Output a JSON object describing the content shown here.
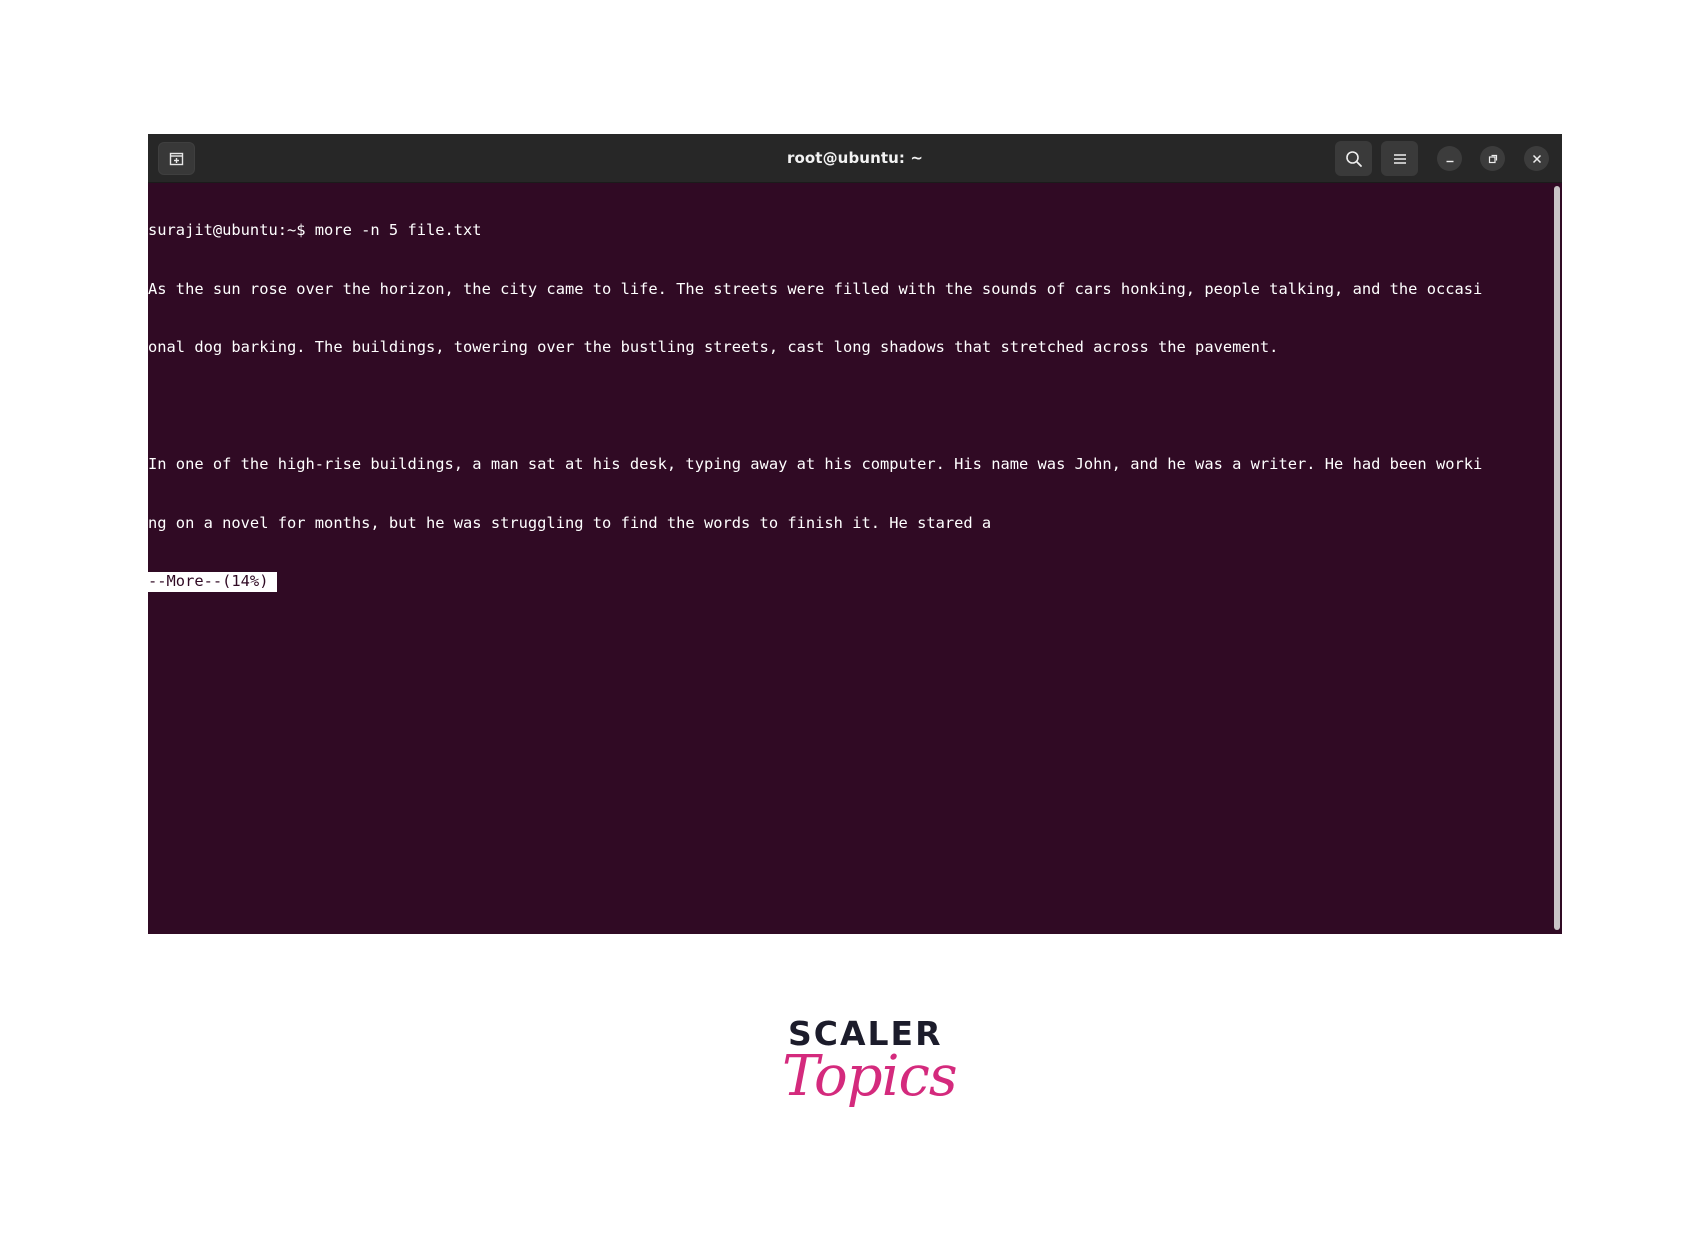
{
  "window": {
    "title": "root@ubuntu: ~"
  },
  "icons": {
    "new_tab": "new-tab-icon",
    "search": "search-icon",
    "menu": "hamburger-menu-icon",
    "minimize": "minimize-icon",
    "maximize": "maximize-icon",
    "close": "close-icon"
  },
  "terminal": {
    "lines": [
      "surajit@ubuntu:~$ more -n 5 file.txt",
      "As the sun rose over the horizon, the city came to life. The streets were filled with the sounds of cars honking, people talking, and the occasi",
      "onal dog barking. The buildings, towering over the bustling streets, cast long shadows that stretched across the pavement.",
      "",
      "In one of the high-rise buildings, a man sat at his desk, typing away at his computer. His name was John, and he was a writer. He had been worki",
      "ng on a novel for months, but he was struggling to find the words to finish it. He stared a"
    ],
    "more_prompt": "--More--(14%)",
    "more_percent": 14
  },
  "colors": {
    "terminal_bg": "#300a24",
    "titlebar_bg": "#272727",
    "text": "#ffffff",
    "logo_dark": "#1c1c2b",
    "logo_pink": "#d42a7d"
  },
  "logo": {
    "line1": "SCALER",
    "line2": "Topics"
  }
}
